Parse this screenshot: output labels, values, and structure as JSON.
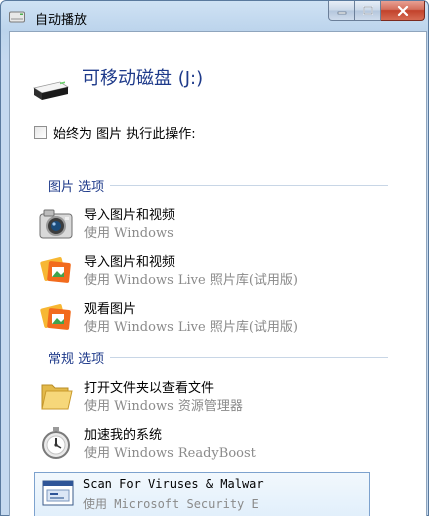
{
  "window": {
    "title": "自动播放",
    "controls": [
      "minimize",
      "maximize",
      "close"
    ]
  },
  "drive": {
    "title": "可移动磁盘 (J:)",
    "icon": "removable-drive-icon"
  },
  "always": {
    "label": "始终为 图片 执行此操作:",
    "checked": false
  },
  "groups": {
    "photos_title": "图片 选项",
    "general_title": "常规 选项"
  },
  "options": [
    {
      "title": "导入图片和视频",
      "subtitle": "使用 Windows",
      "icon": "camera-icon"
    },
    {
      "title": "导入图片和视频",
      "subtitle": "使用 Windows Live 照片库(试用版)",
      "icon": "photo-gallery-icon"
    },
    {
      "title": "观看图片",
      "subtitle": "使用 Windows Live 照片库(试用版)",
      "icon": "photo-gallery-icon"
    },
    {
      "title": "打开文件夹以查看文件",
      "subtitle": "使用 Windows 资源管理器",
      "icon": "folder-icon"
    },
    {
      "title": "加速我的系统",
      "subtitle": "使用 Windows ReadyBoost",
      "icon": "stopwatch-icon"
    },
    {
      "title": "Scan For Viruses & Malwar",
      "subtitle": "使用 Microsoft Security E",
      "icon": "security-scan-icon"
    }
  ]
}
